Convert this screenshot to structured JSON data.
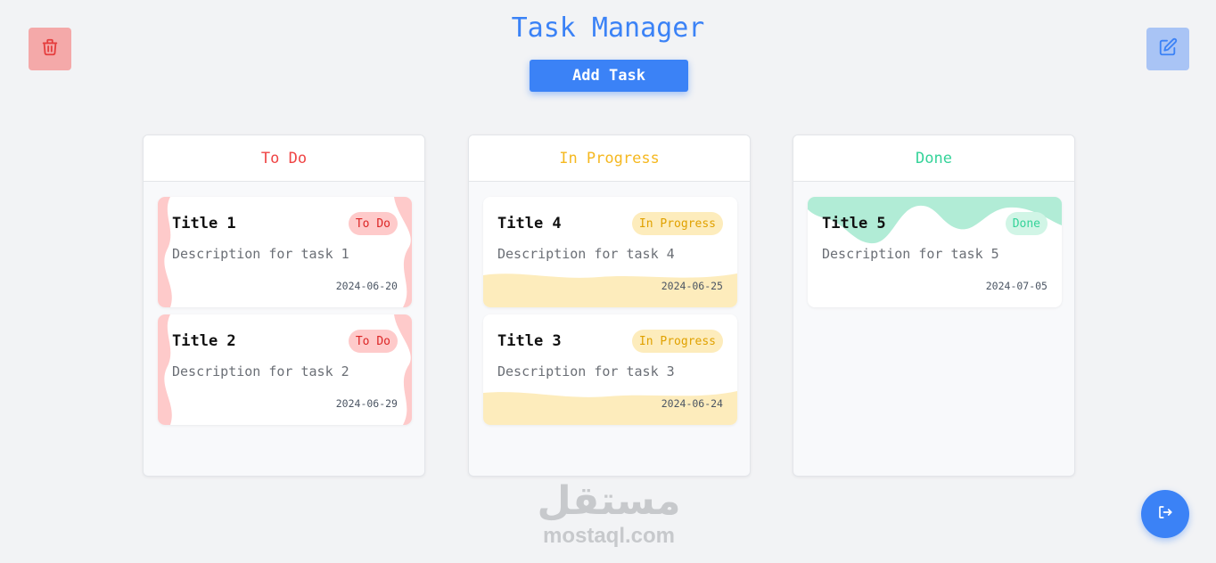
{
  "header": {
    "title": "Task Manager",
    "add_task_label": "Add Task",
    "delete_icon": "trash-icon",
    "edit_icon": "edit-icon"
  },
  "columns": [
    {
      "name": "To Do",
      "color": "#ef4444",
      "cards": [
        {
          "title": "Title 1",
          "status": "To Do",
          "description": "Description for task 1",
          "date": "2024-06-20"
        },
        {
          "title": "Title 2",
          "status": "To Do",
          "description": "Description for task 2",
          "date": "2024-06-29"
        }
      ]
    },
    {
      "name": "In Progress",
      "color": "#f5b820",
      "cards": [
        {
          "title": "Title 4",
          "status": "In Progress",
          "description": "Description for task 4",
          "date": "2024-06-25"
        },
        {
          "title": "Title 3",
          "status": "In Progress",
          "description": "Description for task 3",
          "date": "2024-06-24"
        }
      ]
    },
    {
      "name": "Done",
      "color": "#34d399",
      "cards": [
        {
          "title": "Title 5",
          "status": "Done",
          "description": "Description for task 5",
          "date": "2024-07-05"
        }
      ]
    }
  ],
  "watermark": {
    "arabic": "مستقل",
    "latin": "mostaql.com"
  },
  "footer": {
    "logout_icon": "logout-icon"
  },
  "colors": {
    "primary": "#3b82f6",
    "todo_bg": "#fecaca",
    "progress_bg": "#fdecbc",
    "done_bg": "#b1ecd6"
  }
}
